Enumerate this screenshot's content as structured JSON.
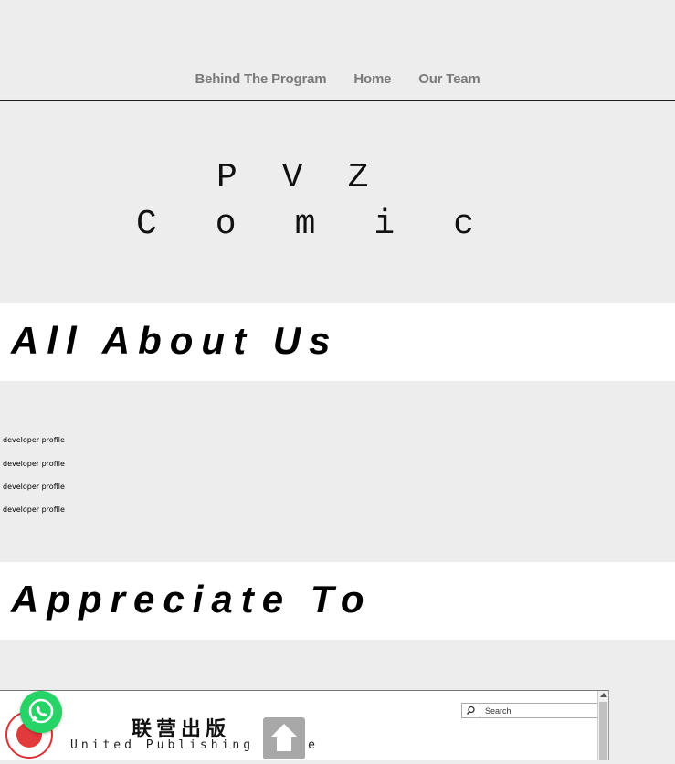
{
  "nav": {
    "links": [
      {
        "label": "Behind The Program"
      },
      {
        "label": "Home"
      },
      {
        "label": "Our Team"
      }
    ]
  },
  "hero": {
    "line1": "PVZ",
    "line2": "Comic"
  },
  "sections": {
    "about_title": "All About Us",
    "appreciate_title": "Appreciate To"
  },
  "profiles": [
    {
      "label": "developer profile"
    },
    {
      "label": "developer profile"
    },
    {
      "label": "developer profile"
    },
    {
      "label": "developer profile"
    }
  ],
  "embed": {
    "cn_title": "联营出版",
    "en_title": "United Publishing House",
    "search_placeholder": "Search"
  },
  "icons": {
    "whatsapp": "whatsapp-icon",
    "back_to_top": "arrow-up-icon",
    "search": "search-icon"
  },
  "colors": {
    "nav_text": "#7a7a7a",
    "background": "#ededed",
    "whatsapp": "#25d366",
    "seal": "#e23a3a"
  }
}
